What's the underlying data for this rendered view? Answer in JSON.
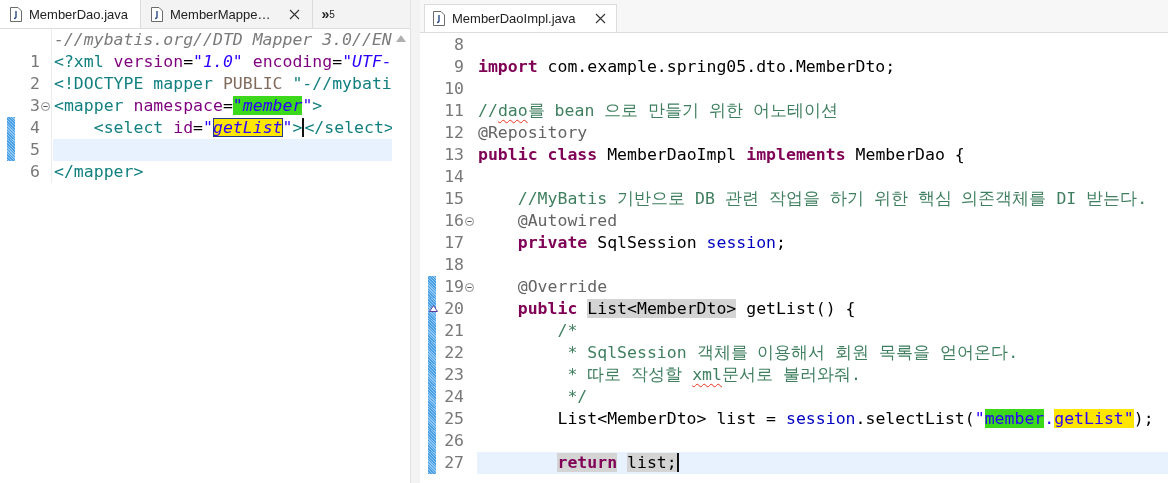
{
  "left_editor": {
    "tabs": [
      {
        "label": "MemberDao.java",
        "selected": false
      },
      {
        "label": "MemberMappe…",
        "selected": true
      }
    ],
    "overflow": {
      "symbol": "»",
      "count": "5"
    },
    "lines": [
      {
        "changed": false,
        "current": false,
        "fold": false,
        "segments": [
          {
            "text": "-//mybatis.org//DTD Mapper 3.0//EN",
            "kind": "doctype-id"
          }
        ]
      },
      {
        "number": "1",
        "changed": false,
        "current": false,
        "fold": false,
        "segments": [
          {
            "text": "<?xml",
            "kind": "tag"
          },
          {
            "text": " version",
            "kind": "attr"
          },
          {
            "text": "=",
            "kind": "plain"
          },
          {
            "text": "\"1.0\"",
            "kind": "value"
          },
          {
            "text": " encoding",
            "kind": "attr"
          },
          {
            "text": "=",
            "kind": "plain"
          },
          {
            "text": "\"UTF-",
            "kind": "value"
          }
        ]
      },
      {
        "number": "2",
        "changed": false,
        "current": false,
        "fold": false,
        "segments": [
          {
            "text": "<!DOCTYPE mapper",
            "kind": "tag"
          },
          {
            "text": " PUBLIC ",
            "kind": "doctype-keyword"
          },
          {
            "text": "\"-//mybati",
            "kind": "tag"
          }
        ]
      },
      {
        "number": "3",
        "changed": false,
        "current": false,
        "fold": true,
        "segments": [
          {
            "text": "<mapper",
            "kind": "tag"
          },
          {
            "text": " namespace",
            "kind": "attr"
          },
          {
            "text": "=",
            "kind": "plain"
          },
          {
            "text": "\"member",
            "kind": "value",
            "color": "#3bd81b"
          },
          {
            "text": "\"",
            "kind": "value"
          },
          {
            "text": ">",
            "kind": "tag"
          }
        ]
      },
      {
        "number": "4",
        "changed": true,
        "current": false,
        "fold": false,
        "segments": [
          {
            "text": "    <select",
            "kind": "tag"
          },
          {
            "text": " id",
            "kind": "attr"
          },
          {
            "text": "=",
            "kind": "plain"
          },
          {
            "text": "\"",
            "kind": "value"
          },
          {
            "text": "getList",
            "kind": "value",
            "color": "#ffe600",
            "boxed": true
          },
          {
            "text": "\"",
            "kind": "value"
          },
          {
            "text": ">",
            "kind": "tag",
            "caret": true
          },
          {
            "text": "</select>",
            "kind": "tag"
          }
        ]
      },
      {
        "number": "5",
        "changed": true,
        "current": true,
        "fold": false
      },
      {
        "number": "6",
        "changed": false,
        "current": false,
        "fold": false,
        "segments": [
          {
            "text": "</mapper>",
            "kind": "tag"
          }
        ]
      }
    ]
  },
  "right_editor": {
    "tabs": [
      {
        "label": "MemberDaoImpl.java",
        "selected": true
      }
    ],
    "lines": [
      {
        "number": "8",
        "changed": false,
        "current": false,
        "fold": false
      },
      {
        "number": "9",
        "changed": false,
        "current": false,
        "fold": false,
        "segments": [
          {
            "text": "import",
            "kind": "keyword"
          },
          {
            "text": " com.example.spring05.dto.MemberDto;",
            "kind": "plain"
          }
        ]
      },
      {
        "number": "10",
        "changed": false,
        "current": false,
        "fold": false
      },
      {
        "number": "11",
        "changed": false,
        "current": false,
        "fold": false,
        "segments": [
          {
            "text": "//",
            "kind": "comment"
          },
          {
            "text": "dao",
            "kind": "comment",
            "squiggle": true
          },
          {
            "text": "를 bean 으로 만들기 위한 어노테이션",
            "kind": "comment"
          }
        ]
      },
      {
        "number": "12",
        "changed": false,
        "current": false,
        "fold": false,
        "segments": [
          {
            "text": "@Repository",
            "kind": "annotation"
          }
        ]
      },
      {
        "number": "13",
        "changed": false,
        "current": false,
        "fold": false,
        "segments": [
          {
            "text": "public class",
            "kind": "keyword"
          },
          {
            "text": " MemberDaoImpl ",
            "kind": "plain"
          },
          {
            "text": "implements",
            "kind": "keyword"
          },
          {
            "text": " MemberDao {",
            "kind": "plain"
          }
        ]
      },
      {
        "number": "14",
        "changed": false,
        "current": false,
        "fold": false
      },
      {
        "number": "15",
        "changed": false,
        "current": false,
        "fold": false,
        "segments": [
          {
            "text": "    //MyBatis 기반으로 DB 관련 작업을 하기 위한 핵심 의존객체를 DI 받는다.",
            "kind": "comment"
          }
        ]
      },
      {
        "number": "16",
        "changed": false,
        "current": false,
        "fold": true,
        "segments": [
          {
            "text": "    @Autowired",
            "kind": "annotation"
          }
        ]
      },
      {
        "number": "17",
        "changed": false,
        "current": false,
        "fold": false,
        "segments": [
          {
            "text": "    private",
            "kind": "keyword"
          },
          {
            "text": " SqlSession ",
            "kind": "plain"
          },
          {
            "text": "session",
            "kind": "field"
          },
          {
            "text": ";",
            "kind": "plain"
          }
        ]
      },
      {
        "number": "18",
        "changed": false,
        "current": false,
        "fold": false
      },
      {
        "number": "19",
        "changed": true,
        "current": false,
        "fold": true,
        "segments": [
          {
            "text": "    @Override",
            "kind": "annotation"
          }
        ]
      },
      {
        "number": "20",
        "changed": true,
        "current": false,
        "fold": false,
        "override": true,
        "segments": [
          {
            "text": "    public ",
            "kind": "keyword"
          },
          {
            "text": "List<MemberDto>",
            "kind": "plain",
            "color": "#d4d4d4"
          },
          {
            "text": " getList() {",
            "kind": "plain"
          }
        ]
      },
      {
        "number": "21",
        "changed": true,
        "current": false,
        "fold": false,
        "segments": [
          {
            "text": "        /*",
            "kind": "comment"
          }
        ]
      },
      {
        "number": "22",
        "changed": true,
        "current": false,
        "fold": false,
        "segments": [
          {
            "text": "         * SqlSession 객체를 이용해서 회원 목록을 얻어온다.",
            "kind": "comment"
          }
        ]
      },
      {
        "number": "23",
        "changed": true,
        "current": false,
        "fold": false,
        "segments": [
          {
            "text": "         * 따로 작성할 ",
            "kind": "comment"
          },
          {
            "text": "xml",
            "kind": "comment",
            "squiggle": true
          },
          {
            "text": "문서로 불러와줘.",
            "kind": "comment"
          }
        ]
      },
      {
        "number": "24",
        "changed": true,
        "current": false,
        "fold": false,
        "segments": [
          {
            "text": "         */",
            "kind": "comment"
          }
        ]
      },
      {
        "number": "25",
        "changed": true,
        "current": false,
        "fold": false,
        "segments": [
          {
            "text": "        List<MemberDto> list = ",
            "kind": "plain"
          },
          {
            "text": "session",
            "kind": "field"
          },
          {
            "text": ".selectList(",
            "kind": "plain"
          },
          {
            "text": "\"",
            "kind": "string"
          },
          {
            "text": "member",
            "kind": "string",
            "color": "#3bd81b"
          },
          {
            "text": ".",
            "kind": "string"
          },
          {
            "text": "getList\"",
            "kind": "string",
            "color": "#ffe600"
          },
          {
            "text": ");",
            "kind": "plain"
          }
        ]
      },
      {
        "number": "26",
        "changed": true,
        "current": false,
        "fold": false
      },
      {
        "number": "27",
        "changed": true,
        "current": true,
        "fold": false,
        "segments": [
          {
            "text": "        return",
            "kind": "keyword",
            "color": "#d4d4d4"
          },
          {
            "text": " list;",
            "kind": "plain",
            "color": "#d4d4d4",
            "caret": true
          }
        ]
      }
    ]
  }
}
